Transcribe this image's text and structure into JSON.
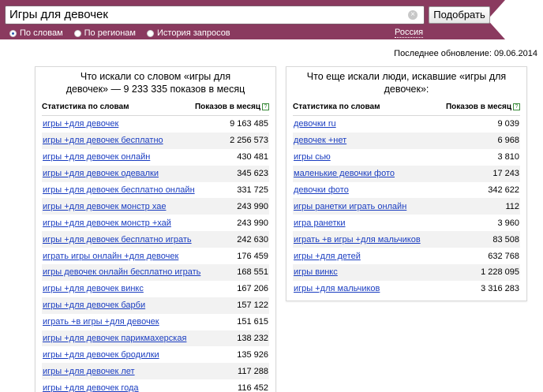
{
  "search": {
    "query": "Игры для девочек",
    "submit_label": "Подобрать",
    "modes": [
      {
        "label": "По словам",
        "checked": true
      },
      {
        "label": "По регионам",
        "checked": false
      },
      {
        "label": "История запросов",
        "checked": false
      }
    ],
    "region": "Россия"
  },
  "last_update": "Последнее обновление: 09.06.2014",
  "left_panel": {
    "title_line1": "Что искали со словом «игры для",
    "title_line2": "девочек» — 9 233 335 показов в месяц",
    "col_keywords": "Статистика по словам",
    "col_impressions": "Показов в месяц",
    "rows": [
      {
        "phrase": "игры +для девочек",
        "count": "9 163 485"
      },
      {
        "phrase": "игры +для девочек бесплатно",
        "count": "2 256 573"
      },
      {
        "phrase": "игры +для девочек онлайн",
        "count": "430 481"
      },
      {
        "phrase": "игры +для девочек одевалки",
        "count": "345 623"
      },
      {
        "phrase": "игры +для девочек бесплатно онлайн",
        "count": "331 725"
      },
      {
        "phrase": "игры +для девочек монстр хае",
        "count": "243 990"
      },
      {
        "phrase": "игры +для девочек монстр +хай",
        "count": "243 990"
      },
      {
        "phrase": "игры +для девочек бесплатно играть",
        "count": "242 630"
      },
      {
        "phrase": "играть игры онлайн +для девочек",
        "count": "176 459"
      },
      {
        "phrase": "игры девочек онлайн бесплатно играть",
        "count": "168 551"
      },
      {
        "phrase": "игры +для девочек винкс",
        "count": "167 206"
      },
      {
        "phrase": "игры +для девочек барби",
        "count": "157 122"
      },
      {
        "phrase": "играть +в игры +для девочек",
        "count": "151 615"
      },
      {
        "phrase": "игры +для девочек парикмахерская",
        "count": "138 232"
      },
      {
        "phrase": "игры +для девочек бродилки",
        "count": "135 926"
      },
      {
        "phrase": "игры +для девочек лет",
        "count": "117 288"
      },
      {
        "phrase": "игры +для девочек года",
        "count": "116 452"
      }
    ]
  },
  "right_panel": {
    "title_line1": "Что еще искали люди, искавшие «игры для",
    "title_line2": "девочек»:",
    "col_keywords": "Статистика по словам",
    "col_impressions": "Показов в месяц",
    "rows": [
      {
        "phrase": "девочки ru",
        "count": "9 039"
      },
      {
        "phrase": "девочек +нет",
        "count": "6 968"
      },
      {
        "phrase": "игры сью",
        "count": "3 810"
      },
      {
        "phrase": "маленькие девочки фото",
        "count": "17 243"
      },
      {
        "phrase": "девочки фото",
        "count": "342 622"
      },
      {
        "phrase": "игры ранетки играть онлайн",
        "count": "112"
      },
      {
        "phrase": "игра ранетки",
        "count": "3 960"
      },
      {
        "phrase": "играть +в игры +для мальчиков",
        "count": "83 508"
      },
      {
        "phrase": "игры +для детей",
        "count": "632 768"
      },
      {
        "phrase": "игры винкс",
        "count": "1 228 095"
      },
      {
        "phrase": "игры +для мальчиков",
        "count": "3 316 283"
      }
    ]
  },
  "colors": {
    "header": "#8a3a5f",
    "link": "#1a3dc1",
    "row_alt": "#f2f2f2"
  }
}
